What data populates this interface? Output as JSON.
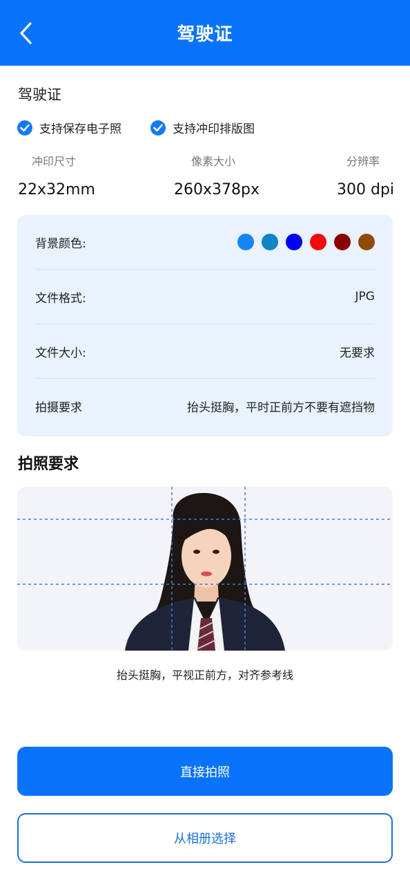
{
  "header": {
    "title": "驾驶证",
    "back_icon": "chevron-left-icon"
  },
  "doc": {
    "title": "驾驶证",
    "features": [
      {
        "label": "支持保存电子照",
        "checked": true
      },
      {
        "label": "支持冲印排版图",
        "checked": true
      }
    ]
  },
  "specs": [
    {
      "label": "冲印尺寸",
      "value": "22x32mm"
    },
    {
      "label": "像素大小",
      "value": "260x378px"
    },
    {
      "label": "分辨率",
      "value": "300 dpi"
    }
  ],
  "details": {
    "background_label": "背景颜色:",
    "background_colors": [
      "#1585f7",
      "#0f84c6",
      "#0000f5",
      "#f30a0a",
      "#8a0101",
      "#8f4a08"
    ],
    "format_label": "文件格式:",
    "format_value": "JPG",
    "size_label": "文件大小:",
    "size_value": "无要求",
    "shoot_label": "拍摄要求",
    "shoot_value": "抬头挺胸，平时正前方不要有遮挡物"
  },
  "photo_section": {
    "title": "拍照要求",
    "caption": "抬头挺胸，平视正前方，对齐参考线"
  },
  "actions": {
    "take_photo": "直接拍照",
    "choose_album": "从相册选择"
  },
  "colors": {
    "primary": "#0a73fb",
    "card_bg": "#e9f2fd"
  }
}
